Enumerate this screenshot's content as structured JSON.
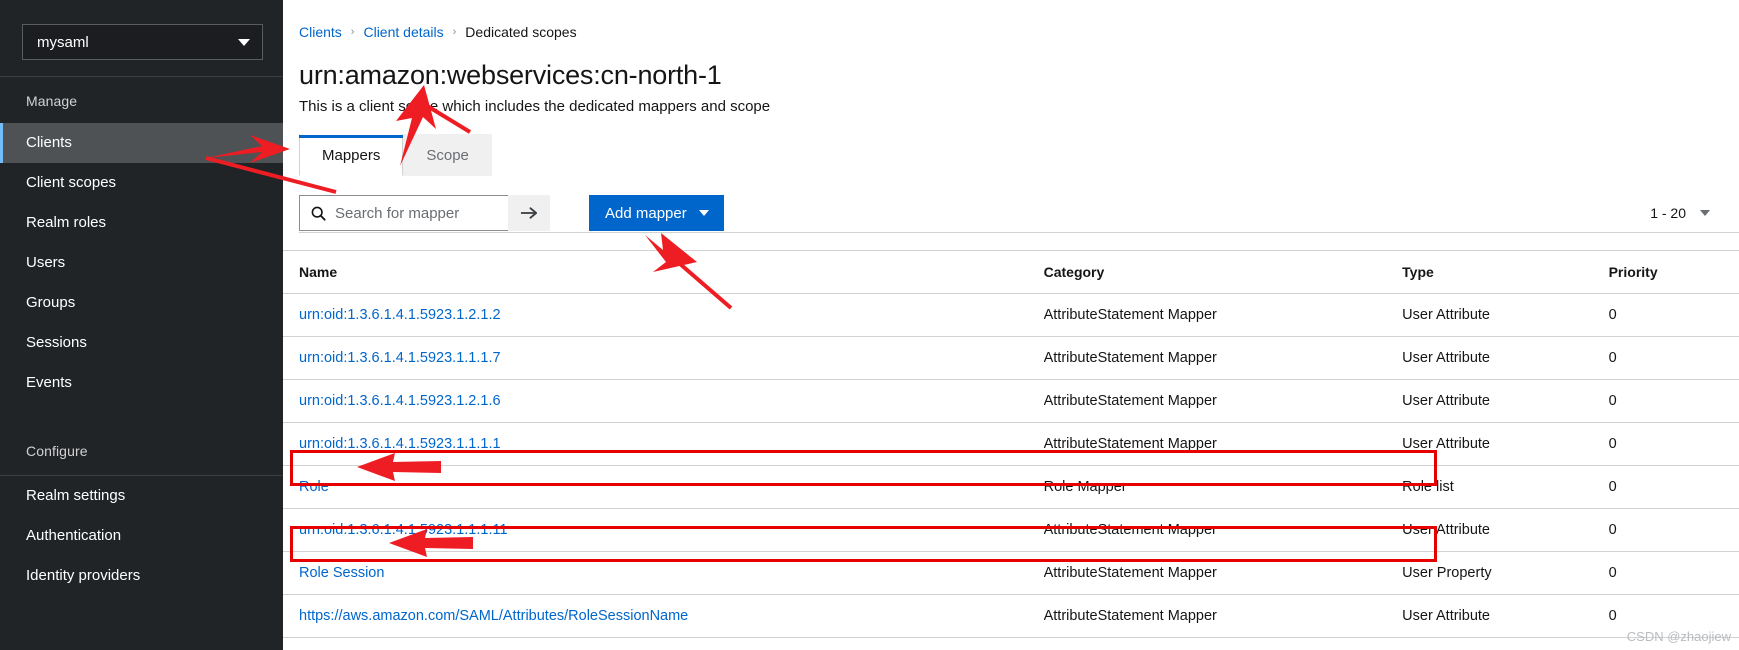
{
  "sidebar": {
    "realm_selector": {
      "value": "mysaml",
      "icon": "chevron-down-icon"
    },
    "sections": [
      {
        "title": "Manage",
        "items": [
          {
            "label": "Clients",
            "active": true
          },
          {
            "label": "Client scopes",
            "active": false
          },
          {
            "label": "Realm roles",
            "active": false
          },
          {
            "label": "Users",
            "active": false
          },
          {
            "label": "Groups",
            "active": false
          },
          {
            "label": "Sessions",
            "active": false
          },
          {
            "label": "Events",
            "active": false
          }
        ]
      },
      {
        "title": "Configure",
        "items": [
          {
            "label": "Realm settings",
            "active": false
          },
          {
            "label": "Authentication",
            "active": false
          },
          {
            "label": "Identity providers",
            "active": false
          }
        ]
      }
    ]
  },
  "breadcrumb": {
    "items": [
      {
        "label": "Clients",
        "link": true
      },
      {
        "label": "Client details",
        "link": true
      },
      {
        "label": "Dedicated scopes",
        "link": false
      }
    ],
    "separator": "›"
  },
  "header": {
    "title": "urn:amazon:webservices:cn-north-1",
    "subtitle": "This is a client scope which includes the dedicated mappers and scope"
  },
  "tabs": [
    {
      "label": "Mappers",
      "active": true
    },
    {
      "label": "Scope",
      "active": false
    }
  ],
  "toolbar": {
    "search": {
      "placeholder": "Search for mapper",
      "value": "",
      "icon": "search-icon",
      "submit_icon": "arrow-right-icon"
    },
    "add_mapper": {
      "label": "Add mapper",
      "caret_icon": "chevron-down-icon",
      "color": "#0066cc"
    },
    "pagination": {
      "label": "1 - 20",
      "caret_icon": "chevron-down-icon"
    }
  },
  "table": {
    "columns": [
      "Name",
      "Category",
      "Type",
      "Priority"
    ],
    "rows": [
      {
        "name": "urn:oid:1.3.6.1.4.1.5923.1.2.1.2",
        "category": "AttributeStatement Mapper",
        "type": "User Attribute",
        "priority": "0",
        "highlight": false
      },
      {
        "name": "urn:oid:1.3.6.1.4.1.5923.1.1.1.7",
        "category": "AttributeStatement Mapper",
        "type": "User Attribute",
        "priority": "0",
        "highlight": false
      },
      {
        "name": "urn:oid:1.3.6.1.4.1.5923.1.2.1.6",
        "category": "AttributeStatement Mapper",
        "type": "User Attribute",
        "priority": "0",
        "highlight": false
      },
      {
        "name": "urn:oid:1.3.6.1.4.1.5923.1.1.1.1",
        "category": "AttributeStatement Mapper",
        "type": "User Attribute",
        "priority": "0",
        "highlight": false
      },
      {
        "name": "Role",
        "category": "Role Mapper",
        "type": "Role list",
        "priority": "0",
        "highlight": true
      },
      {
        "name": "urn:oid:1.3.6.1.4.1.5923.1.1.1.11",
        "category": "AttributeStatement Mapper",
        "type": "User Attribute",
        "priority": "0",
        "highlight": false
      },
      {
        "name": "Role Session",
        "category": "AttributeStatement Mapper",
        "type": "User Property",
        "priority": "0",
        "highlight": true
      },
      {
        "name": "https://aws.amazon.com/SAML/Attributes/RoleSessionName",
        "category": "AttributeStatement Mapper",
        "type": "User Attribute",
        "priority": "0",
        "highlight": false
      }
    ]
  },
  "annotations": {
    "highlight_color": "#e60000",
    "arrow_color": "#ee1c23",
    "watermark": "CSDN @zhaojiew"
  }
}
